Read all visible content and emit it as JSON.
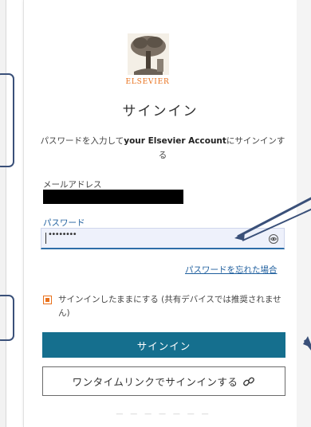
{
  "brand": {
    "logo_text": "ELSEVIER",
    "accent_color": "#e9711c",
    "primary_color": "#156f8e",
    "link_color": "#1f5f9e"
  },
  "page": {
    "title": "サインイン"
  },
  "subtitle": {
    "prefix": "パスワードを入力して",
    "account": "your Elsevier Account",
    "suffix": "にサインインする"
  },
  "email": {
    "label": "メールアドレス"
  },
  "password": {
    "label": "パスワード",
    "masked_value": "••••••••"
  },
  "forgot_link": "パスワードを忘れた場合",
  "remember": {
    "label": "サインインしたままにする (共有デバイスでは推奨されません)"
  },
  "signin_button": "サインイン",
  "otl_button": "ワンタイムリンクでサインインする",
  "icons": {
    "eye": "eye-icon",
    "link": "link-icon",
    "logo": "elsevier-tree-logo"
  },
  "annotation_color": "#3a5079"
}
